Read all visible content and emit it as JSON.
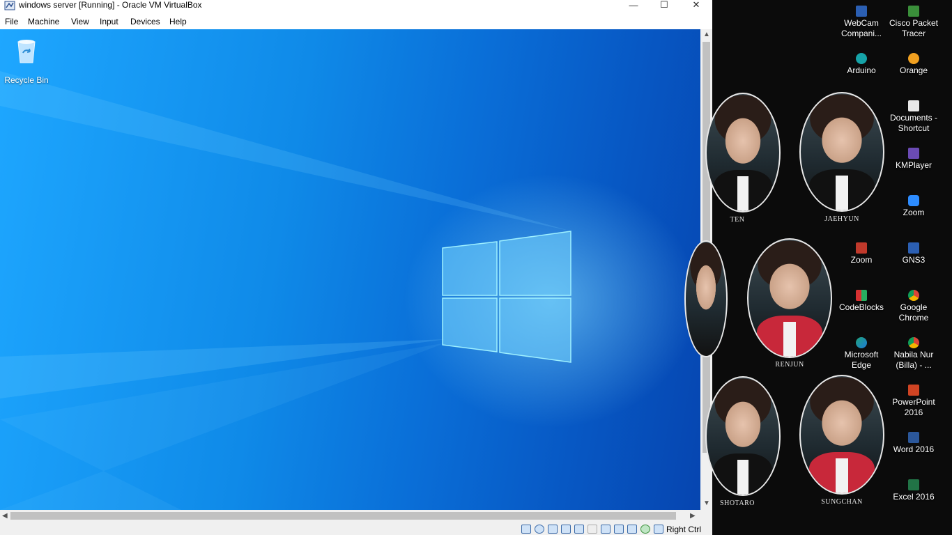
{
  "window": {
    "title": "windows server [Running] - Oracle VM VirtualBox",
    "controls": {
      "minimize": "—",
      "maximize": "☐",
      "close": "✕"
    }
  },
  "menu": [
    "File",
    "Machine",
    "View",
    "Input",
    "Devices",
    "Help"
  ],
  "guest": {
    "recycle_bin_label": "Recycle Bin"
  },
  "statusbar": {
    "host_key": "Right Ctrl",
    "icons": [
      "hard-disk-icon",
      "optical-drive-icon",
      "audio-icon",
      "network-icon",
      "usb-icon",
      "shared-folders-icon",
      "display-icon",
      "video-capture-icon",
      "cpu-icon",
      "guest-additions-icon",
      "mouse-integration-icon"
    ]
  },
  "host_desktop": {
    "portraits": [
      "TEN",
      "JAEHYUN",
      "RENJUN",
      "SHOTARO",
      "SUNGCHAN"
    ],
    "icons": [
      {
        "label": "WebCam Compani...",
        "color": "#2b5fb3"
      },
      {
        "label": "Cisco Packet Tracer",
        "color": "#3a8f3a"
      },
      {
        "label": "Arduino",
        "color": "#16a3a8"
      },
      {
        "label": "Orange",
        "color": "#f0a020"
      },
      {
        "label": "Documents - Shortcut",
        "color": "#e8e8e8"
      },
      {
        "label": "KMPlayer",
        "color": "#6b4bb5"
      },
      {
        "label": "Zoom",
        "color": "#2d8cff"
      },
      {
        "label": "Zoom",
        "color": "#c0392b"
      },
      {
        "label": "GNS3",
        "color": "#2b5fb3"
      },
      {
        "label": "CodeBlocks",
        "color": "#d63031"
      },
      {
        "label": "Google Chrome",
        "color": "#f4b400"
      },
      {
        "label": "Microsoft Edge",
        "color": "#1fa37a"
      },
      {
        "label": "Nabila Nur (Billa) - ...",
        "color": "#e67e22"
      },
      {
        "label": "PowerPoint 2016",
        "color": "#d04423"
      },
      {
        "label": "Word 2016",
        "color": "#2b579a"
      },
      {
        "label": "Excel 2016",
        "color": "#217346"
      }
    ]
  }
}
